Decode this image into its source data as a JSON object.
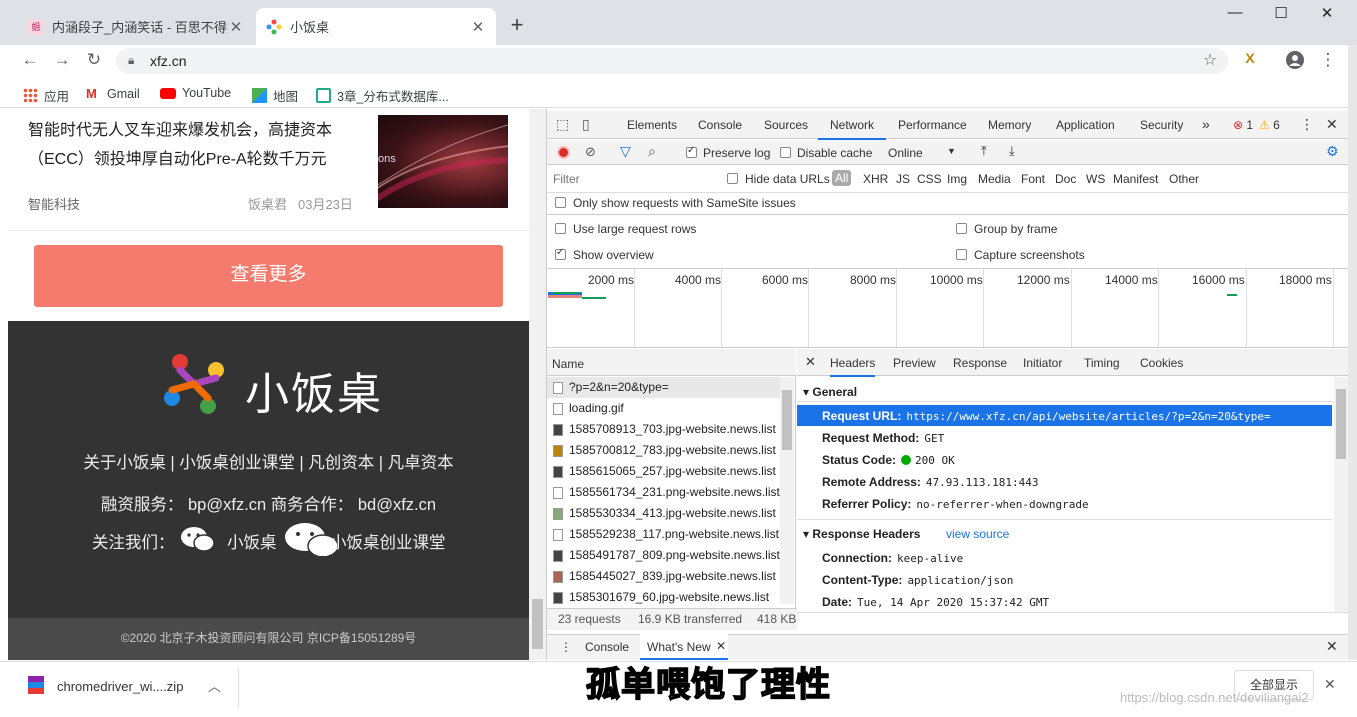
{
  "browser": {
    "tabs": [
      {
        "title": "内涵段子_内涵笑话 - 百思不得姐",
        "active": false
      },
      {
        "title": "小饭桌",
        "active": true
      }
    ],
    "url": "xfz.cn",
    "bookmarks": [
      {
        "label": "应用",
        "icon": "apps-grid-icon"
      },
      {
        "label": "Gmail",
        "icon": "gmail-icon"
      },
      {
        "label": "YouTube",
        "icon": "youtube-icon"
      },
      {
        "label": "地图",
        "icon": "maps-icon"
      },
      {
        "label": "3章_分布式数据库...",
        "icon": "bookmark-page-icon"
      }
    ]
  },
  "page": {
    "article": {
      "title": "智能时代无人叉车迎来爆发机会，高捷资本（ECC）领投坤厚自动化Pre-A轮数千万元",
      "category": "智能科技",
      "author": "饭桌君",
      "date": "03月23日",
      "image_text": "ons"
    },
    "more_button": "查看更多",
    "footer": {
      "logo_text": "小饭桌",
      "links": "关于小饭桌 | 小饭桌创业课堂 | 凡创资本 | 凡卓资本",
      "contact": "融资服务：  bp@xfz.cn  商务合作：  bd@xfz.cn",
      "follow_label": "关注我们：",
      "follow_1": "小饭桌",
      "follow_2": "小饭桌创业课堂",
      "copyright": "©2020 北京子木投资顾问有限公司 京ICP备15051289号"
    }
  },
  "devtools": {
    "tabs": [
      "Elements",
      "Console",
      "Sources",
      "Network",
      "Performance",
      "Memory",
      "Application",
      "Security"
    ],
    "active_tab": "Network",
    "more_tabs": "»",
    "errors": "1",
    "warnings": "6",
    "controls": {
      "preserve_log": "Preserve log",
      "disable_cache": "Disable cache",
      "throttle": "Online"
    },
    "filter": {
      "placeholder": "Filter",
      "hide_data_urls": "Hide data URLs",
      "types": [
        "All",
        "XHR",
        "JS",
        "CSS",
        "Img",
        "Media",
        "Font",
        "Doc",
        "WS",
        "Manifest",
        "Other"
      ],
      "samesite": "Only show requests with SameSite issues"
    },
    "options": {
      "large_rows": "Use large request rows",
      "show_overview": "Show overview",
      "group_by_frame": "Group by frame",
      "capture_screenshots": "Capture screenshots"
    },
    "timeline_labels": [
      "2000 ms",
      "4000 ms",
      "6000 ms",
      "8000 ms",
      "10000 ms",
      "12000 ms",
      "14000 ms",
      "16000 ms",
      "18000 ms"
    ],
    "requests_header": "Name",
    "requests": [
      "?p=2&n=20&type=",
      "loading.gif",
      "1585708913_703.jpg-website.news.list",
      "1585700812_783.jpg-website.news.list",
      "1585615065_257.jpg-website.news.list",
      "1585561734_231.png-website.news.list",
      "1585530334_413.jpg-website.news.list",
      "1585529238_117.png-website.news.list",
      "1585491787_809.png-website.news.list",
      "1585445027_839.jpg-website.news.list",
      "1585301679_60.jpg-website.news.list"
    ],
    "status": {
      "requests": "23 requests",
      "transferred": "16.9 KB transferred",
      "size": "418 KB"
    },
    "detail_tabs": [
      "Headers",
      "Preview",
      "Response",
      "Initiator",
      "Timing",
      "Cookies"
    ],
    "general": {
      "title": "General",
      "request_url_label": "Request URL:",
      "request_url": "https://www.xfz.cn/api/website/articles/?p=2&n=20&type=",
      "method_label": "Request Method:",
      "method": "GET",
      "status_label": "Status Code:",
      "status": "200 OK",
      "remote_label": "Remote Address:",
      "remote": "47.93.113.181:443",
      "referrer_label": "Referrer Policy:",
      "referrer": "no-referrer-when-downgrade"
    },
    "response_headers": {
      "title": "Response Headers",
      "view_source": "view source",
      "connection_label": "Connection:",
      "connection": "keep-alive",
      "ctype_label": "Content-Type:",
      "ctype": "application/json",
      "date_label": "Date:",
      "date": "Tue, 14 Apr 2020 15:37:42 GMT"
    },
    "drawer_tabs": [
      "Console",
      "What's New"
    ]
  },
  "download": {
    "file": "chromedriver_wi....zip",
    "show_all": "全部显示"
  },
  "overlay": {
    "subtitle": "孤单喂饱了理性",
    "watermark": "https://blog.csdn.net/deviliangai2"
  },
  "colors": {
    "accent": "#1a73e8",
    "more_button": "#f47b6e",
    "footer_bg": "#333333",
    "record_red": "#d93025"
  }
}
